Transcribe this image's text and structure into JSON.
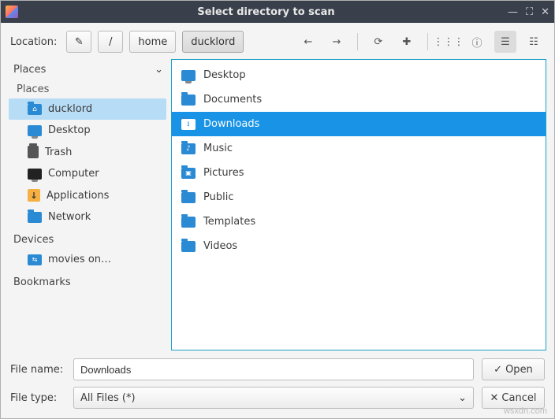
{
  "window": {
    "title": "Select directory to scan"
  },
  "toolbar": {
    "location_label": "Location:",
    "path": {
      "root_glyph": "/",
      "seg1": "home",
      "seg2": "ducklord"
    },
    "nav": {
      "back_glyph": "←",
      "forward_glyph": "→",
      "reload_glyph": "⟳",
      "newfolder_glyph": "✚",
      "grid_glyph": "⋮⋮⋮",
      "info_glyph": "ⓘ",
      "list_glyph": "☰",
      "detail_glyph": "☷"
    }
  },
  "sidebar": {
    "header_places": "Places",
    "header_places_sub": "Places",
    "header_devices": "Devices",
    "header_bookmarks": "Bookmarks",
    "items": [
      {
        "label": "ducklord"
      },
      {
        "label": "Desktop"
      },
      {
        "label": "Trash"
      },
      {
        "label": "Computer"
      },
      {
        "label": "Applications"
      },
      {
        "label": "Network"
      }
    ],
    "devices": [
      {
        "label": "movies on…"
      }
    ]
  },
  "files": [
    {
      "label": "Desktop"
    },
    {
      "label": "Documents"
    },
    {
      "label": "Downloads"
    },
    {
      "label": "Music"
    },
    {
      "label": "Pictures"
    },
    {
      "label": "Public"
    },
    {
      "label": "Templates"
    },
    {
      "label": "Videos"
    }
  ],
  "footer": {
    "filename_label": "File name:",
    "filename_value": "Downloads",
    "filetype_label": "File type:",
    "filetype_value": "All Files (*)",
    "open_label": "Open",
    "cancel_label": "Cancel",
    "open_glyph": "✓",
    "cancel_glyph": "✕",
    "combo_chevron": "⌄"
  },
  "watermark": "wsxdn.com"
}
